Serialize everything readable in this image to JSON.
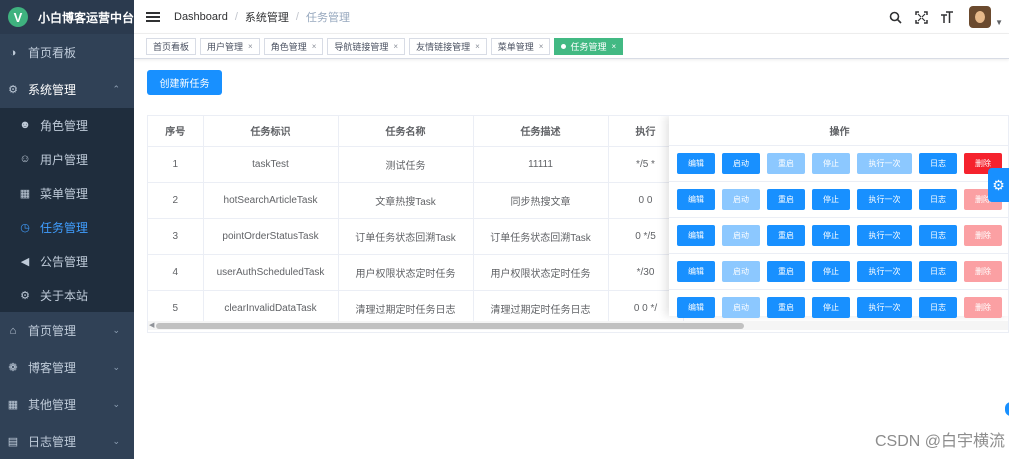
{
  "app": {
    "logo_letter": "V",
    "title": "小白博客运营中台"
  },
  "sidebar": {
    "items": [
      {
        "label": "首页看板",
        "icon": "dashboard-icon"
      },
      {
        "label": "系统管理",
        "icon": "gear-icon",
        "expanded": true,
        "children": [
          {
            "label": "角色管理",
            "icon": "user-icon"
          },
          {
            "label": "用户管理",
            "icon": "user-outline-icon"
          },
          {
            "label": "菜单管理",
            "icon": "grid-icon"
          },
          {
            "label": "任务管理",
            "icon": "clock-icon",
            "active": true
          },
          {
            "label": "公告管理",
            "icon": "speaker-icon"
          },
          {
            "label": "关于本站",
            "icon": "cog-icon"
          }
        ]
      },
      {
        "label": "首页管理",
        "icon": "home-icon"
      },
      {
        "label": "博客管理",
        "icon": "aperture-icon"
      },
      {
        "label": "其他管理",
        "icon": "grid-icon"
      },
      {
        "label": "日志管理",
        "icon": "document-icon"
      }
    ]
  },
  "breadcrumb": [
    "Dashboard",
    "系统管理",
    "任务管理"
  ],
  "tags": [
    {
      "label": "首页看板",
      "closable": false
    },
    {
      "label": "用户管理",
      "closable": true
    },
    {
      "label": "角色管理",
      "closable": true
    },
    {
      "label": "导航链接管理",
      "closable": true
    },
    {
      "label": "友情链接管理",
      "closable": true
    },
    {
      "label": "菜单管理",
      "closable": true
    },
    {
      "label": "任务管理",
      "closable": true,
      "active": true
    }
  ],
  "toolbar": {
    "create_label": "创建新任务"
  },
  "table": {
    "columns": [
      "序号",
      "任务标识",
      "任务名称",
      "任务描述",
      "执行"
    ],
    "ops_header": "操作",
    "rows": [
      [
        "1",
        "taskTest",
        "测试任务",
        "11111",
        "*/5 *"
      ],
      [
        "2",
        "hotSearchArticleTask",
        "文章热搜Task",
        "同步热搜文章",
        "0 0"
      ],
      [
        "3",
        "pointOrderStatusTask",
        "订单任务状态回溯Task",
        "订单任务状态回溯Task",
        "0 */5"
      ],
      [
        "4",
        "userAuthScheduledTask",
        "用户权限状态定时任务",
        "用户权限状态定时任务",
        "*/30"
      ],
      [
        "5",
        "clearInvalidDataTask",
        "清理过期定时任务日志",
        "清理过期定时任务日志",
        "0 0 */"
      ]
    ],
    "op_labels": {
      "edit": "编辑",
      "start": "启动",
      "restart": "重启",
      "stop": "停止",
      "run_once": "执行一次",
      "log": "日志",
      "delete": "删除"
    },
    "op_states": [
      {
        "start": true,
        "restart": false,
        "stop": false,
        "run_once": false,
        "delete": true
      },
      {
        "start": false,
        "restart": true,
        "stop": true,
        "run_once": true,
        "delete": false
      },
      {
        "start": false,
        "restart": true,
        "stop": true,
        "run_once": true,
        "delete": false
      },
      {
        "start": false,
        "restart": true,
        "stop": true,
        "run_once": true,
        "delete": false
      },
      {
        "start": false,
        "restart": true,
        "stop": true,
        "run_once": true,
        "delete": false
      }
    ]
  },
  "watermark": "CSDN @白宇横流",
  "colors": {
    "sidebar_bg": "#304156",
    "primary": "#1890ff",
    "danger": "#f5222d",
    "tag_active": "#42b983"
  }
}
